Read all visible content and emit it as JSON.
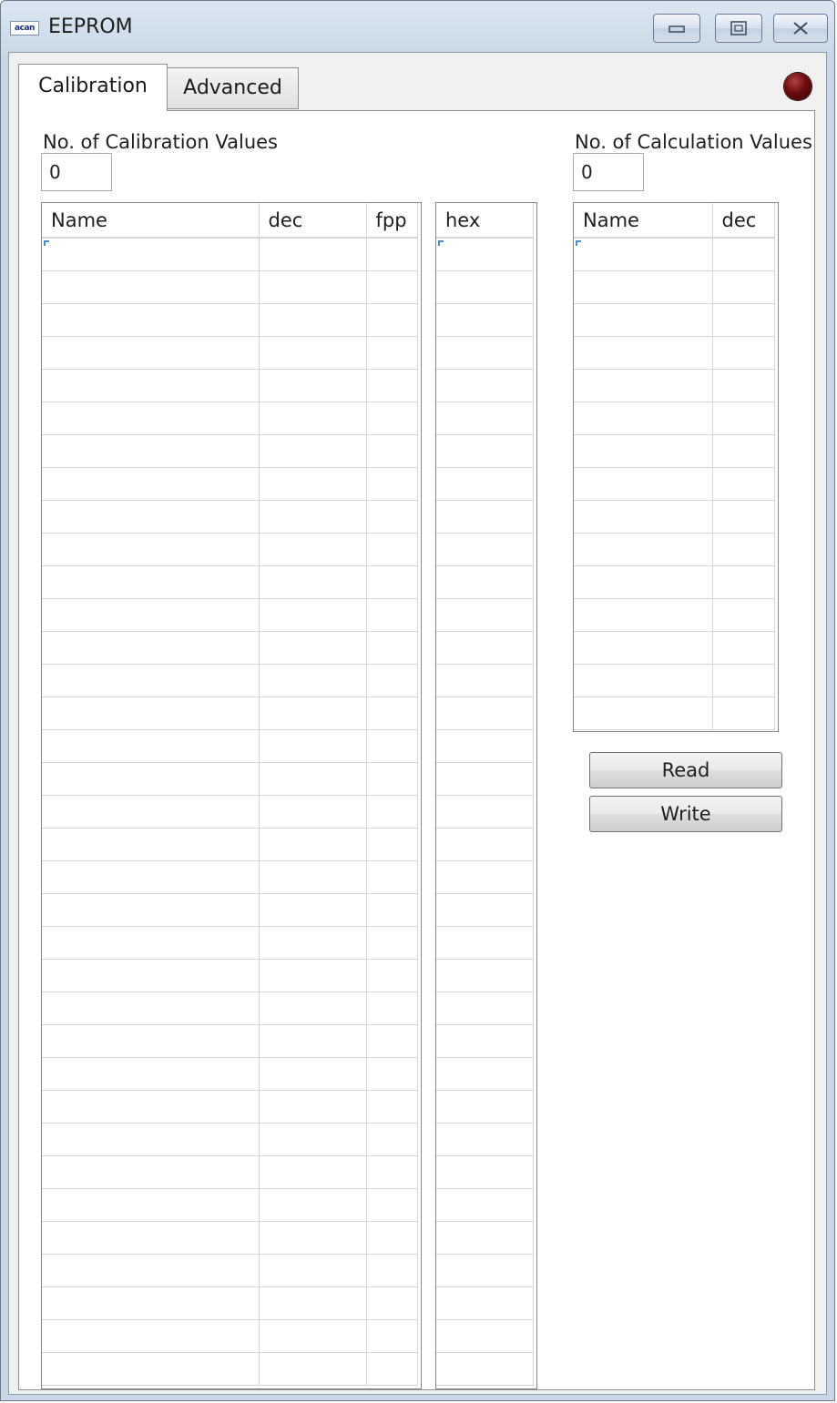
{
  "window": {
    "app_icon_text": "acan",
    "title": "EEPROM"
  },
  "tabs": [
    {
      "label": "Calibration",
      "active": true
    },
    {
      "label": "Advanced",
      "active": false
    }
  ],
  "calibration": {
    "count_label": "No. of Calibration Values",
    "count_value": "0",
    "columns": [
      "Name",
      "dec",
      "fpp"
    ],
    "hex_column": "hex",
    "rows": []
  },
  "calculation": {
    "count_label": "No. of Calculation Values",
    "count_value": "0",
    "columns": [
      "Name",
      "dec"
    ],
    "rows": []
  },
  "buttons": {
    "read_label": "Read",
    "write_label": "Write"
  },
  "colors": {
    "status_led": "#6a0c0c",
    "title_bar": "#c9d8e8"
  }
}
